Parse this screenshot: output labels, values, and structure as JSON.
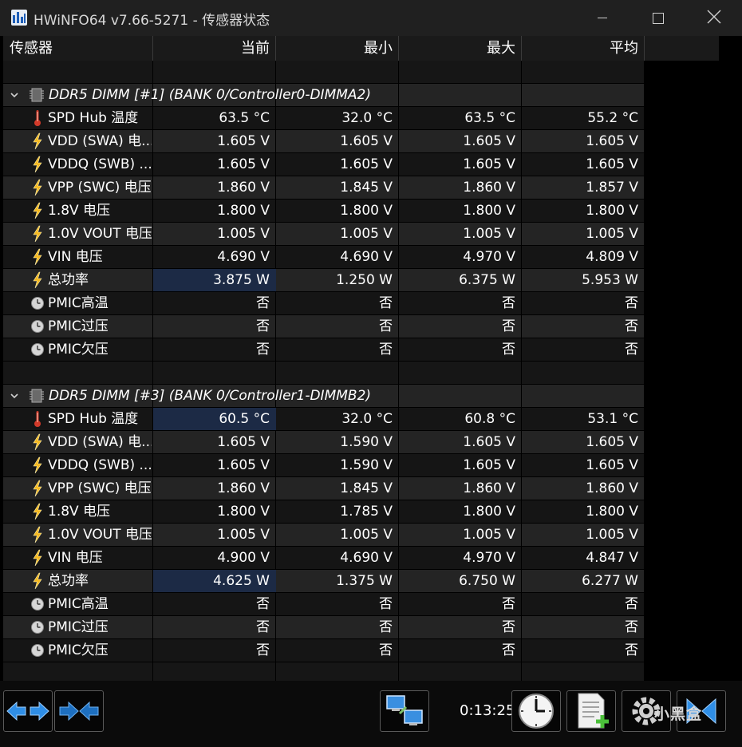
{
  "window": {
    "title": "HWiNFO64 v7.66-5271 - 传感器状态"
  },
  "columns": [
    "传感器",
    "当前",
    "最小",
    "最大",
    "平均"
  ],
  "groups": [
    {
      "title": "DDR5 DIMM [#1] (BANK 0/Controller0-DIMMA2)",
      "rows": [
        {
          "icon": "thermometer",
          "name": "SPD Hub 温度",
          "cur": "63.5 °C",
          "min": "32.0 °C",
          "max": "63.5 °C",
          "avg": "55.2 °C"
        },
        {
          "icon": "lightning",
          "name": "VDD (SWA) 电...",
          "cur": "1.605 V",
          "min": "1.605 V",
          "max": "1.605 V",
          "avg": "1.605 V"
        },
        {
          "icon": "lightning",
          "name": "VDDQ (SWB) ...",
          "cur": "1.605 V",
          "min": "1.605 V",
          "max": "1.605 V",
          "avg": "1.605 V"
        },
        {
          "icon": "lightning",
          "name": "VPP (SWC) 电压",
          "cur": "1.860 V",
          "min": "1.845 V",
          "max": "1.860 V",
          "avg": "1.857 V"
        },
        {
          "icon": "lightning",
          "name": "1.8V 电压",
          "cur": "1.800 V",
          "min": "1.800 V",
          "max": "1.800 V",
          "avg": "1.800 V"
        },
        {
          "icon": "lightning",
          "name": "1.0V VOUT 电压",
          "cur": "1.005 V",
          "min": "1.005 V",
          "max": "1.005 V",
          "avg": "1.005 V"
        },
        {
          "icon": "lightning",
          "name": "VIN 电压",
          "cur": "4.690 V",
          "min": "4.690 V",
          "max": "4.970 V",
          "avg": "4.809 V"
        },
        {
          "icon": "lightning",
          "name": "总功率",
          "cur": "3.875 W",
          "min": "1.250 W",
          "max": "6.375 W",
          "avg": "5.953 W",
          "highlight": true
        },
        {
          "icon": "clock",
          "name": "PMIC高温",
          "cur": "否",
          "min": "否",
          "max": "否",
          "avg": "否"
        },
        {
          "icon": "clock",
          "name": "PMIC过压",
          "cur": "否",
          "min": "否",
          "max": "否",
          "avg": "否"
        },
        {
          "icon": "clock",
          "name": "PMIC欠压",
          "cur": "否",
          "min": "否",
          "max": "否",
          "avg": "否"
        }
      ]
    },
    {
      "title": "DDR5 DIMM [#3] (BANK 0/Controller1-DIMMB2)",
      "rows": [
        {
          "icon": "thermometer",
          "name": "SPD Hub 温度",
          "cur": "60.5 °C",
          "min": "32.0 °C",
          "max": "60.8 °C",
          "avg": "53.1 °C",
          "highlight": true
        },
        {
          "icon": "lightning",
          "name": "VDD (SWA) 电...",
          "cur": "1.605 V",
          "min": "1.590 V",
          "max": "1.605 V",
          "avg": "1.605 V"
        },
        {
          "icon": "lightning",
          "name": "VDDQ (SWB) ...",
          "cur": "1.605 V",
          "min": "1.590 V",
          "max": "1.605 V",
          "avg": "1.605 V"
        },
        {
          "icon": "lightning",
          "name": "VPP (SWC) 电压",
          "cur": "1.860 V",
          "min": "1.845 V",
          "max": "1.860 V",
          "avg": "1.860 V"
        },
        {
          "icon": "lightning",
          "name": "1.8V 电压",
          "cur": "1.800 V",
          "min": "1.785 V",
          "max": "1.800 V",
          "avg": "1.800 V"
        },
        {
          "icon": "lightning",
          "name": "1.0V VOUT 电压",
          "cur": "1.005 V",
          "min": "1.005 V",
          "max": "1.005 V",
          "avg": "1.005 V"
        },
        {
          "icon": "lightning",
          "name": "VIN 电压",
          "cur": "4.900 V",
          "min": "4.690 V",
          "max": "4.970 V",
          "avg": "4.847 V"
        },
        {
          "icon": "lightning",
          "name": "总功率",
          "cur": "4.625 W",
          "min": "1.375 W",
          "max": "6.750 W",
          "avg": "6.277 W",
          "highlight": true
        },
        {
          "icon": "clock",
          "name": "PMIC高温",
          "cur": "否",
          "min": "否",
          "max": "否",
          "avg": "否"
        },
        {
          "icon": "clock",
          "name": "PMIC过压",
          "cur": "否",
          "min": "否",
          "max": "否",
          "avg": "否"
        },
        {
          "icon": "clock",
          "name": "PMIC欠压",
          "cur": "否",
          "min": "否",
          "max": "否",
          "avg": "否"
        }
      ]
    }
  ],
  "toolbar": {
    "timer": "0:13:25",
    "watermark": "小黑盒",
    "buttons": [
      "expand-arrows-icon",
      "collapse-arrows-icon",
      "network-icon",
      "clock-icon",
      "report-add-icon",
      "settings-icon",
      "close-sensors-icon"
    ]
  },
  "colors": {
    "highlight": "#1c2a45",
    "row_even": "#242424",
    "row_odd": "#151515",
    "lightning": "#f5b81f",
    "thermometer": "#d23a2a",
    "accent_blue": "#2f8ee6"
  }
}
